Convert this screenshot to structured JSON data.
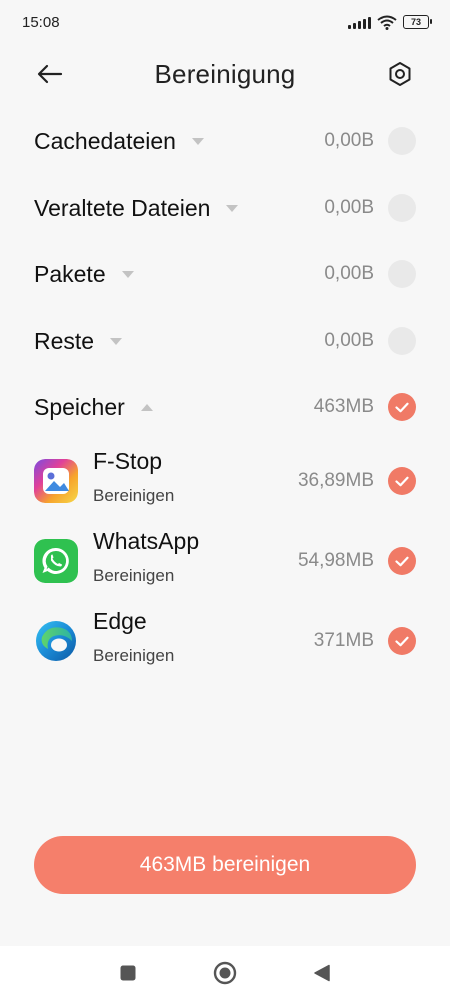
{
  "status_bar": {
    "time": "15:08",
    "battery": "73"
  },
  "header": {
    "title": "Bereinigung"
  },
  "categories": [
    {
      "label": "Cachedateien",
      "size": "0,00B",
      "expanded": false,
      "checked": false
    },
    {
      "label": "Veraltete Dateien",
      "size": "0,00B",
      "expanded": false,
      "checked": false
    },
    {
      "label": "Pakete",
      "size": "0,00B",
      "expanded": false,
      "checked": false
    },
    {
      "label": "Reste",
      "size": "0,00B",
      "expanded": false,
      "checked": false
    },
    {
      "label": "Speicher",
      "size": "463MB",
      "expanded": true,
      "checked": true
    }
  ],
  "apps": [
    {
      "name": "F-Stop",
      "action": "Bereinigen",
      "size": "36,89MB",
      "checked": true,
      "icon": "f-stop-icon"
    },
    {
      "name": "WhatsApp",
      "action": "Bereinigen",
      "size": "54,98MB",
      "checked": true,
      "icon": "whatsapp-icon"
    },
    {
      "name": "Edge",
      "action": "Bereinigen",
      "size": "371MB",
      "checked": true,
      "icon": "edge-icon"
    }
  ],
  "clean_button": {
    "label": "463MB bereinigen"
  },
  "colors": {
    "accent": "#f57f6b",
    "check_on": "#f07a66",
    "check_off": "#e9e9e9"
  }
}
